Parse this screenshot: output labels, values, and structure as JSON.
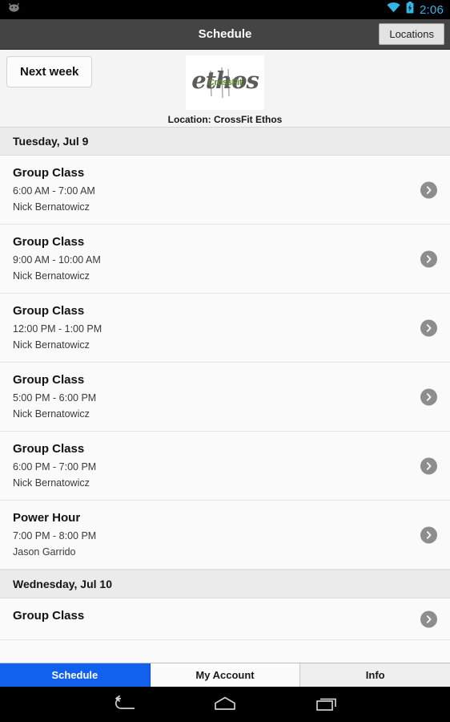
{
  "statusbar": {
    "clock": "2:06",
    "icons": [
      "android-mascot-icon",
      "wifi-icon",
      "battery-charging-icon"
    ]
  },
  "actionbar": {
    "title": "Schedule",
    "locations_button": "Locations"
  },
  "header": {
    "next_week_button": "Next week",
    "logo_text": "ethos",
    "logo_overlay_text": "CrossFit",
    "logo_overlay_color": "#5f8a2f",
    "location_label": "Location: CrossFit Ethos"
  },
  "schedule": {
    "days": [
      {
        "date_label": "Tuesday, Jul 9",
        "classes": [
          {
            "title": "Group Class",
            "time": "6:00 AM - 7:00 AM",
            "coach": "Nick Bernatowicz"
          },
          {
            "title": "Group Class",
            "time": "9:00 AM - 10:00 AM",
            "coach": "Nick Bernatowicz"
          },
          {
            "title": "Group Class",
            "time": "12:00 PM - 1:00 PM",
            "coach": "Nick Bernatowicz"
          },
          {
            "title": "Group Class",
            "time": "5:00 PM - 6:00 PM",
            "coach": "Nick Bernatowicz"
          },
          {
            "title": "Group Class",
            "time": "6:00 PM - 7:00 PM",
            "coach": "Nick Bernatowicz"
          },
          {
            "title": "Power Hour",
            "time": "7:00 PM - 8:00 PM",
            "coach": "Jason Garrido"
          }
        ]
      },
      {
        "date_label": "Wednesday, Jul 10",
        "classes": [
          {
            "title": "Group Class",
            "time": "",
            "coach": ""
          }
        ]
      }
    ]
  },
  "tabbar": {
    "tabs": [
      {
        "label": "Schedule",
        "active": true
      },
      {
        "label": "My Account",
        "active": false
      },
      {
        "label": "Info",
        "active": false
      }
    ],
    "active_color": "#1161ee"
  },
  "navbar": {
    "buttons": [
      "back-icon",
      "home-icon",
      "recents-icon"
    ]
  }
}
